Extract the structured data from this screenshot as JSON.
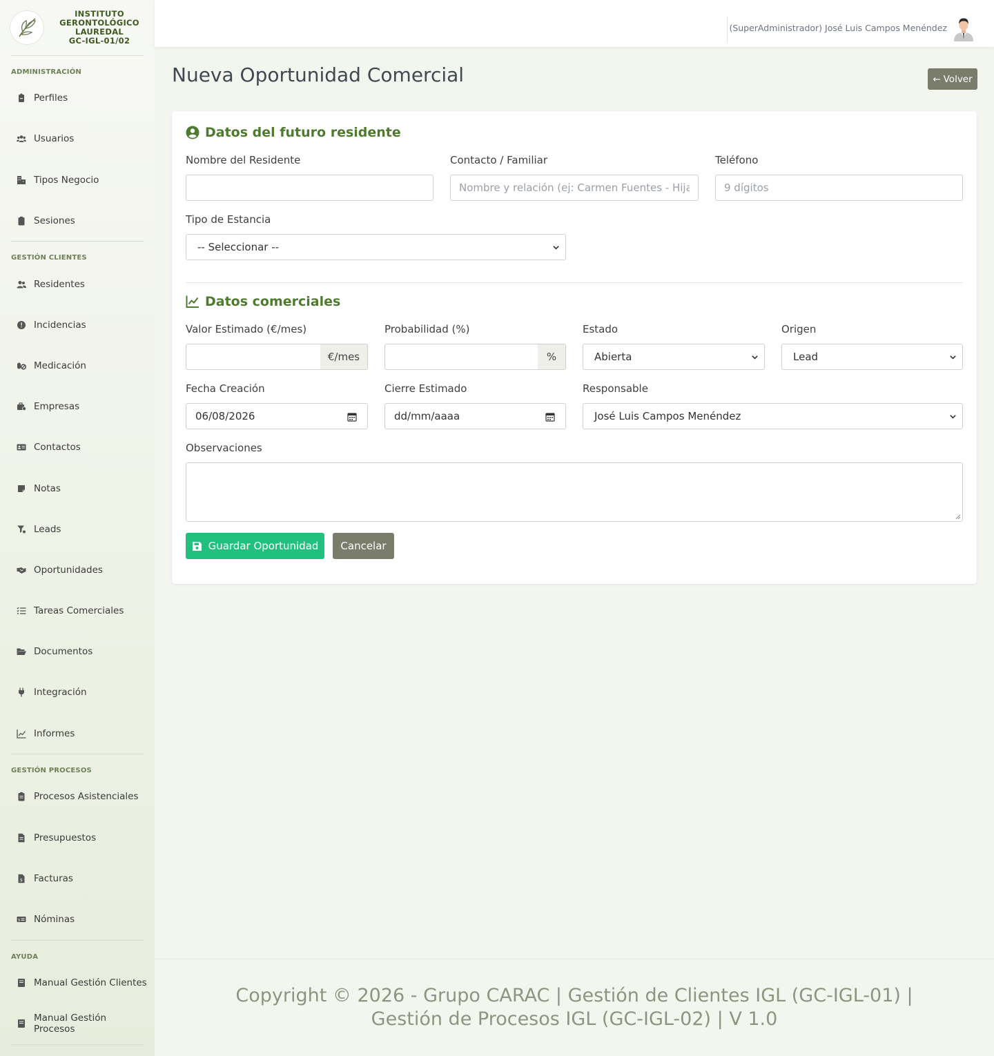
{
  "brand": {
    "lines": [
      "INSTITUTO",
      "GERONTOLÓGICO",
      "LAUREDAL",
      "GC-IGL-01/02"
    ]
  },
  "sidebar": {
    "sections": [
      {
        "title": "ADMINISTRACIÓN",
        "items": [
          "Perfiles",
          "Usuarios",
          "Tipos Negocio",
          "Sesiones"
        ]
      },
      {
        "title": "GESTIÓN CLIENTES",
        "items": [
          "Residentes",
          "Incidencias",
          "Medicación",
          "Empresas",
          "Contactos",
          "Notas",
          "Leads",
          "Oportunidades",
          "Tareas Comerciales",
          "Documentos",
          "Integración",
          "Informes"
        ]
      },
      {
        "title": "GESTIÓN PROCESOS",
        "items": [
          "Procesos Asistenciales",
          "Presupuestos",
          "Facturas",
          "Nóminas"
        ]
      },
      {
        "title": "AYUDA",
        "items": [
          "Manual Gestión Clientes",
          "Manual Gestión Procesos"
        ]
      }
    ]
  },
  "topbar": {
    "user": "(SuperAdministrador) José Luis Campos Menéndez"
  },
  "page": {
    "title": "Nueva Oportunidad Comercial",
    "back_label": "Volver"
  },
  "form": {
    "section_resident": "Datos del futuro residente",
    "nombre_label": "Nombre del Residente",
    "nombre_value": "",
    "contacto_label": "Contacto / Familiar",
    "contacto_placeholder": "Nombre y relación (ej: Carmen Fuentes - Hija)",
    "telefono_label": "Teléfono",
    "telefono_placeholder": "9 dígitos",
    "estancia_label": "Tipo de Estancia",
    "estancia_value": "-- Seleccionar --",
    "section_commercial": "Datos comerciales",
    "valor_label": "Valor Estimado (€/mes)",
    "valor_addon": "€/mes",
    "prob_label": "Probabilidad (%)",
    "prob_addon": "%",
    "estado_label": "Estado",
    "estado_value": "Abierta",
    "origen_label": "Origen",
    "origen_value": "Lead",
    "fecha_label": "Fecha Creación",
    "fecha_value": "06/08/2026",
    "cierre_label": "Cierre Estimado",
    "cierre_value": "dd/mm/aaaa",
    "responsable_label": "Responsable",
    "responsable_value": "José Luis Campos Menéndez",
    "obs_label": "Observaciones",
    "save_label": "Guardar Oportunidad",
    "cancel_label": "Cancelar"
  },
  "footer": {
    "text": "Copyright © 2026 - Grupo CARAC | Gestión de Clientes IGL (GC-IGL-01) | Gestión de Procesos IGL (GC-IGL-02) | V 1.0"
  },
  "colors": {
    "accent_green": "#4f7b31",
    "save_button": "#22c07e",
    "neutral_button": "#7a7d6c"
  }
}
